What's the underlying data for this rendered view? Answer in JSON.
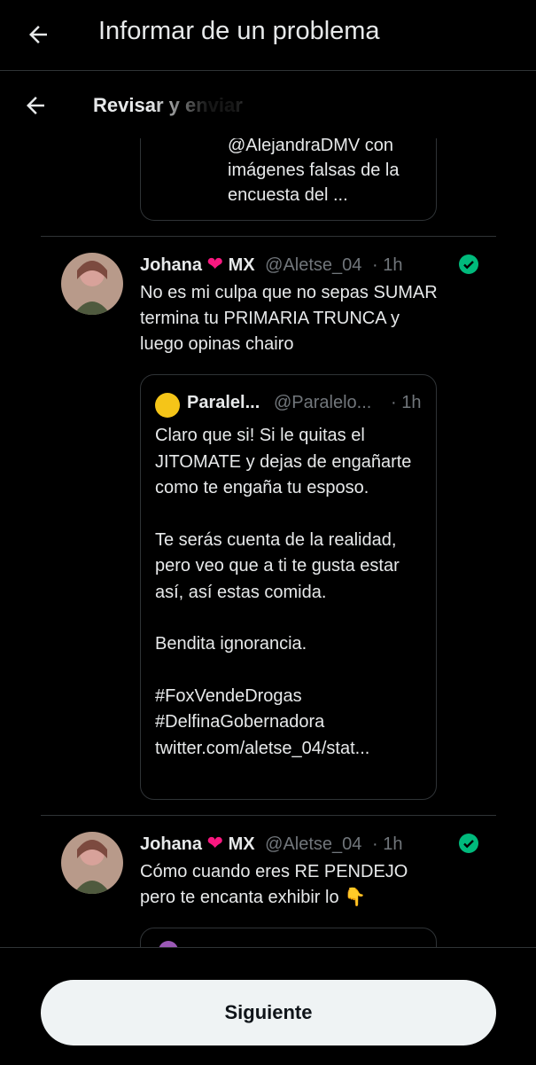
{
  "header": {
    "title": "Informar de un problema"
  },
  "subheader": {
    "title": "Revisar y enviar"
  },
  "top_quote": {
    "text": "@AlejandraDMV con imágenes  falsas de la encuesta del ..."
  },
  "tweets": [
    {
      "name": "Johana",
      "suffix": "MX",
      "handle": "@Aletse_04",
      "time": "· 1h",
      "text": "No es mi culpa que no sepas SUMAR termina tu PRIMARIA TRUNCA y luego opinas chairo",
      "quote": {
        "name": "Paralel...",
        "handle": "@Paralelo...",
        "time": "· 1h",
        "paragraphs": [
          "Claro que si! Si le quitas el JITOMATE y dejas de engañarte como te engaña tu esposo.",
          "Te serás cuenta de la realidad, pero veo que a ti te gusta estar así, así estas comida.",
          "Bendita ignorancia.",
          "#FoxVendeDrogas",
          "#DelfinaGobernadora",
          "twitter.com/aletse_04/stat..."
        ]
      }
    },
    {
      "name": "Johana",
      "suffix": "MX",
      "handle": "@Aletse_04",
      "time": "· 1h",
      "text": "Cómo cuando eres RE PENDEJO pero te encanta exhibir lo 👇"
    }
  ],
  "footer": {
    "button_label": "Siguiente"
  },
  "colors": {
    "accent_check": "#00ba7c",
    "heart": "#f91880",
    "button_bg": "#eff3f4"
  },
  "icons": [
    "back-arrow-icon",
    "heart-icon",
    "check-circle-icon"
  ]
}
